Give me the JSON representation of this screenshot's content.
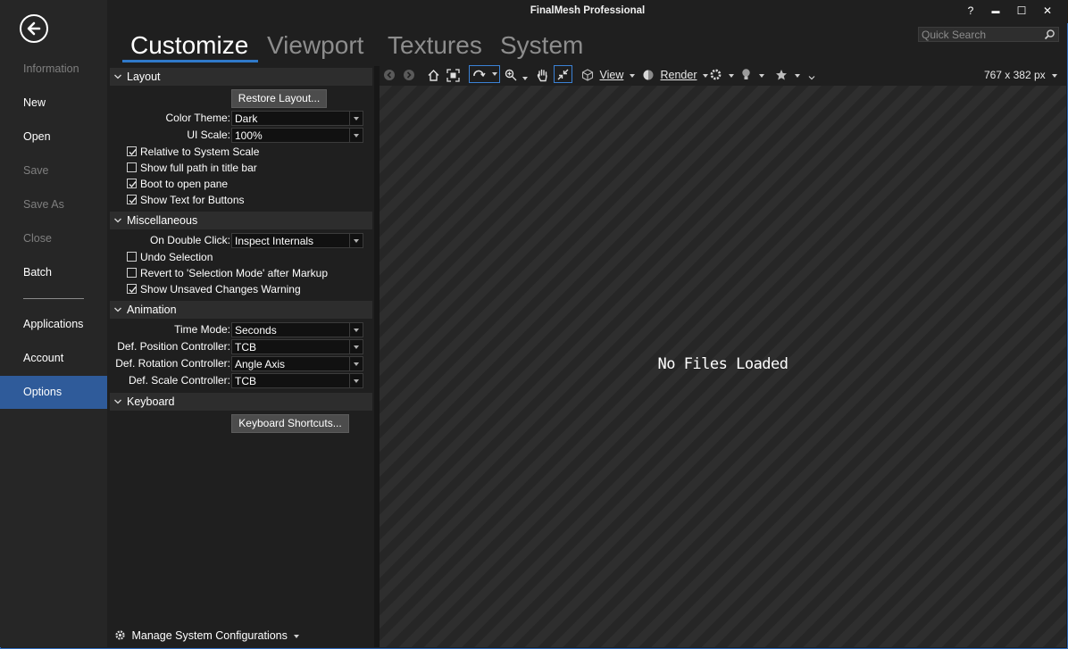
{
  "app": {
    "title": "FinalMesh Professional",
    "help": "?",
    "minimize": "▬",
    "maximize": "☐",
    "close": "✕"
  },
  "search": {
    "placeholder": "Quick Search"
  },
  "nav": {
    "items": [
      {
        "label": "Information",
        "state": "disabled"
      },
      {
        "label": "New",
        "state": "normal"
      },
      {
        "label": "Open",
        "state": "normal"
      },
      {
        "label": "Save",
        "state": "disabled"
      },
      {
        "label": "Save As",
        "state": "disabled"
      },
      {
        "label": "Close",
        "state": "disabled"
      },
      {
        "label": "Batch",
        "state": "normal"
      },
      {
        "label": "Applications",
        "state": "normal"
      },
      {
        "label": "Account",
        "state": "normal"
      },
      {
        "label": "Options",
        "state": "active"
      }
    ]
  },
  "tabs": [
    "Customize",
    "Viewport",
    "Textures",
    "System"
  ],
  "layout": {
    "title": "Layout",
    "restore_button": "Restore Layout...",
    "color_theme_label": "Color Theme:",
    "color_theme_value": "Dark",
    "ui_scale_label": "UI Scale:",
    "ui_scale_value": "100%",
    "checks": [
      {
        "label": "Relative to System Scale",
        "checked": true
      },
      {
        "label": "Show full path in title bar",
        "checked": false
      },
      {
        "label": "Boot to open pane",
        "checked": true
      },
      {
        "label": "Show Text for Buttons",
        "checked": true
      }
    ]
  },
  "misc": {
    "title": "Miscellaneous",
    "double_click_label": "On Double Click:",
    "double_click_value": "Inspect Internals",
    "checks": [
      {
        "label": "Undo Selection",
        "checked": false
      },
      {
        "label": "Revert to 'Selection Mode' after Markup",
        "checked": false
      },
      {
        "label": "Show Unsaved Changes Warning",
        "checked": true
      }
    ]
  },
  "animation": {
    "title": "Animation",
    "rows": [
      {
        "label": "Time Mode:",
        "value": "Seconds"
      },
      {
        "label": "Def. Position Controller:",
        "value": "TCB"
      },
      {
        "label": "Def. Rotation Controller:",
        "value": "Angle Axis"
      },
      {
        "label": "Def. Scale Controller:",
        "value": "TCB"
      }
    ]
  },
  "keyboard": {
    "title": "Keyboard",
    "shortcuts_button": "Keyboard Shortcuts..."
  },
  "footer": {
    "manage_label": "Manage System Configurations"
  },
  "toolbar": {
    "view_label": "View",
    "render_label": "Render",
    "size_label": "767 x 382 px"
  },
  "viewport": {
    "empty_text": "No Files Loaded"
  },
  "colors": {
    "accent": "#2f79c9",
    "active_nav": "#2f5b9a",
    "window_border": "#2f6bbd"
  }
}
